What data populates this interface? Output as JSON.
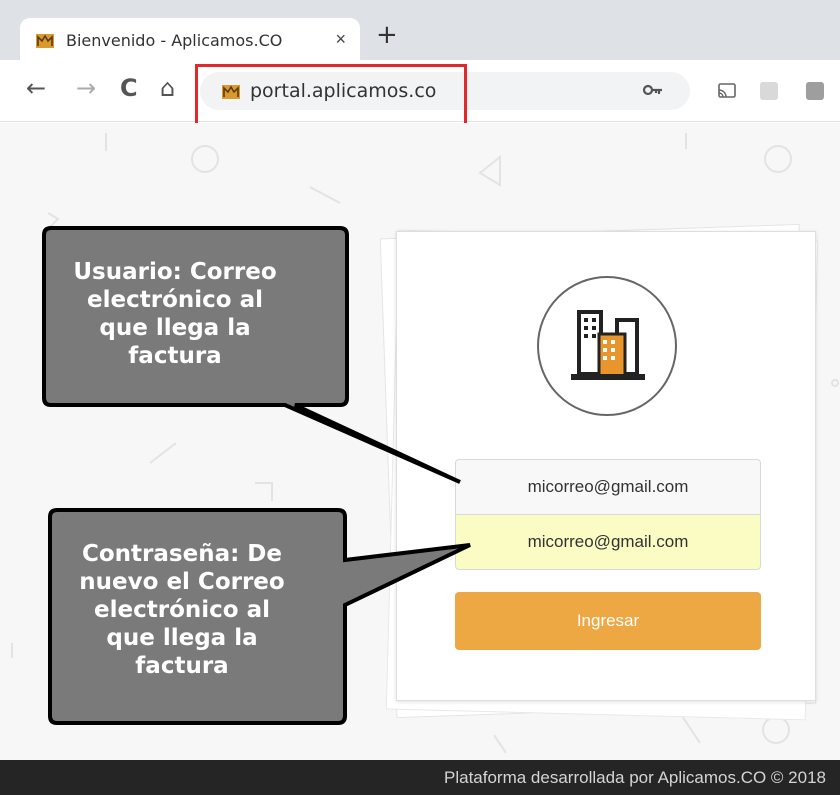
{
  "browser": {
    "tab_title": "Bienvenido - Aplicamos.CO",
    "tab_close": "×",
    "new_tab": "+",
    "nav": {
      "back": "←",
      "forward": "→",
      "reload": "C",
      "home": "⌂"
    },
    "url": "portal.aplicamos.co",
    "key_icon": "key-icon"
  },
  "login": {
    "user_value": "micorreo@gmail.com",
    "password_value": "micorreo@gmail.com",
    "submit_label": "Ingresar",
    "accent_color": "#eda844",
    "autofill_color": "#fbfcc3"
  },
  "callouts": {
    "user_lines": [
      "Usuario: Correo",
      "electrónico al",
      "que llega la",
      "factura"
    ],
    "password_lines": [
      "Contraseña: De",
      "nuevo el Correo",
      "electrónico al",
      "que llega la",
      "factura"
    ],
    "box_color": "#7a7a7a",
    "highlight_color": "#e2272d"
  },
  "footer": {
    "text": "Plataforma desarrollada por Aplicamos.CO © 2018"
  }
}
